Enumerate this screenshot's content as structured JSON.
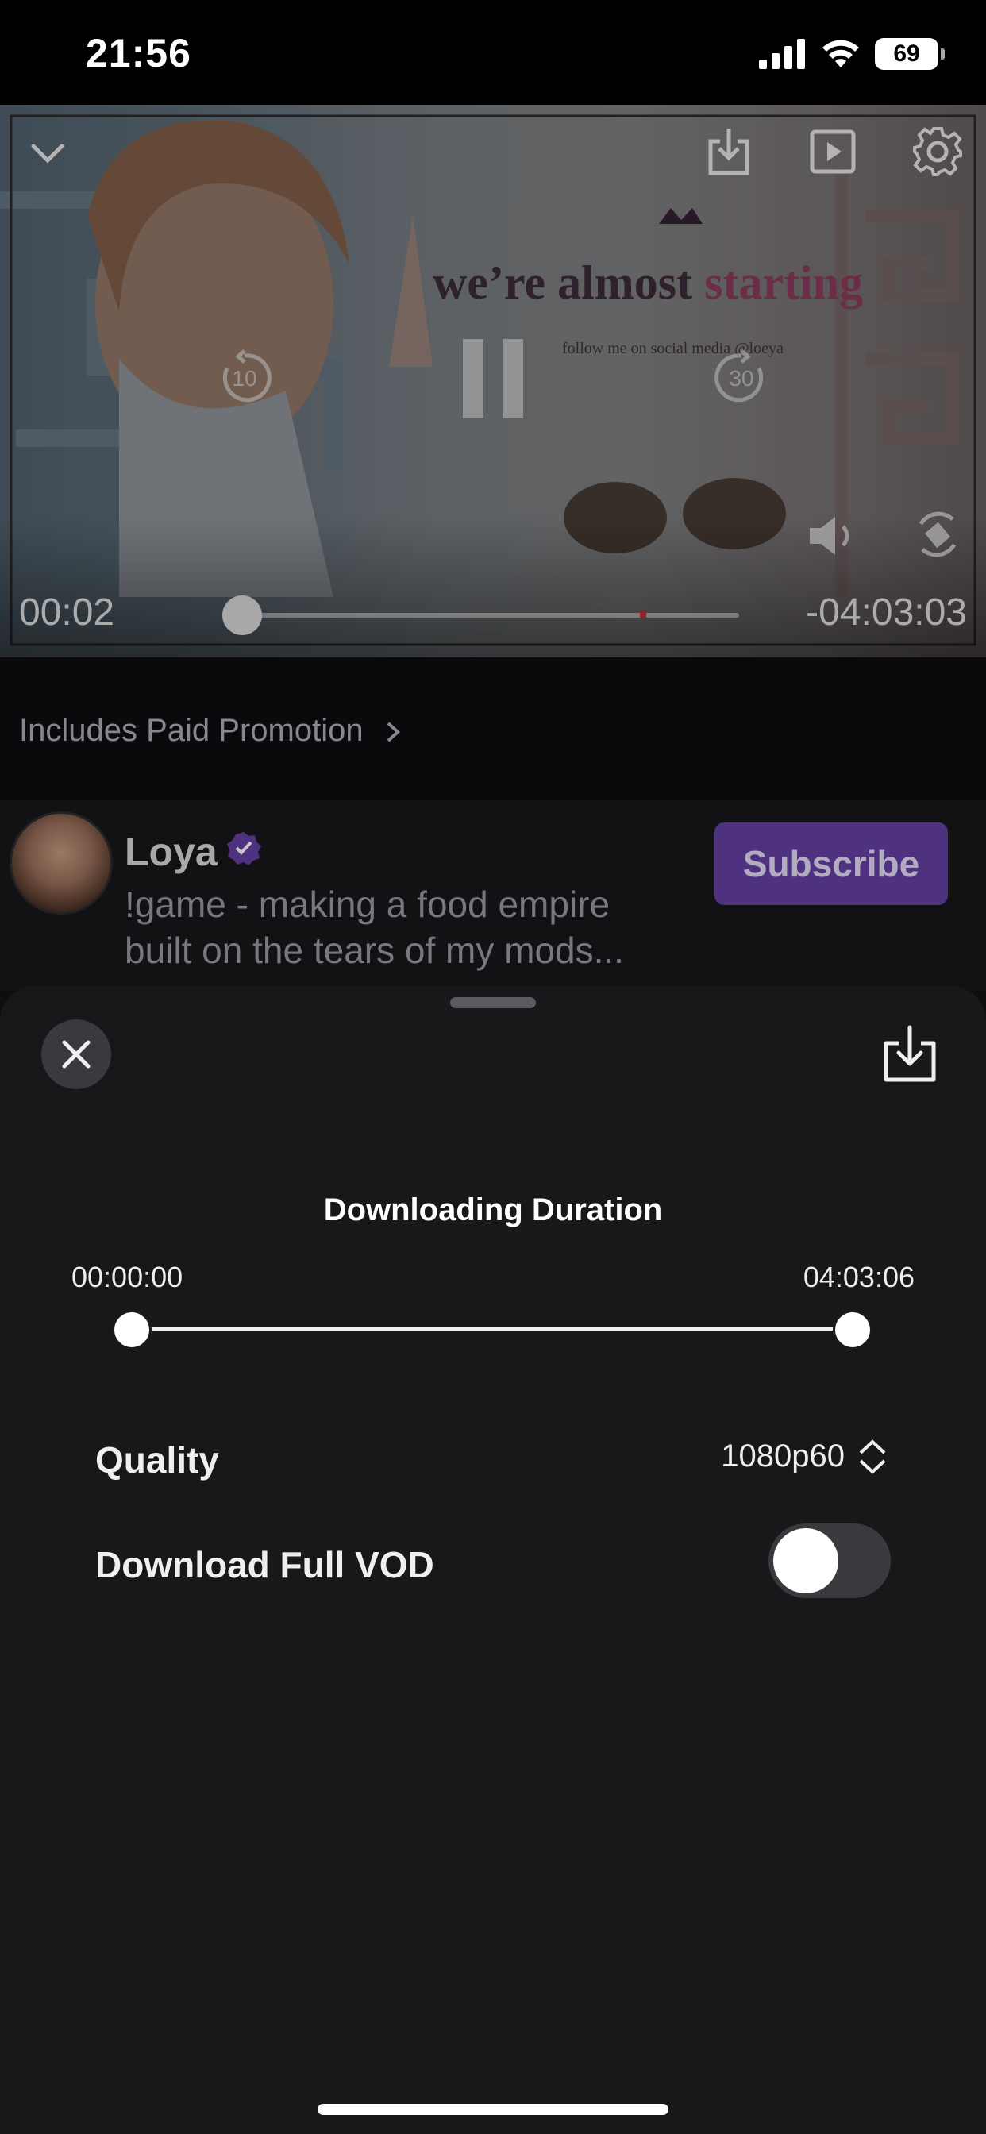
{
  "status_bar": {
    "time": "21:56",
    "battery": "69"
  },
  "video": {
    "overlay_title_main": "we’re almost",
    "overlay_title_accent": "starting",
    "overlay_subtitle": "follow me on social media @loeya",
    "rewind_label": "10",
    "forward_label": "30",
    "elapsed": "00:02",
    "remaining": "-04:03:03",
    "progress": 0.0
  },
  "promo": {
    "label": "Includes Paid Promotion"
  },
  "channel": {
    "name": "Loya",
    "title": "!game - making a food empire built on the tears of my mods...",
    "subscribe_label": "Subscribe"
  },
  "download_sheet": {
    "heading": "Downloading Duration",
    "range_start": "00:00:00",
    "range_end": "04:03:06",
    "range_start_fraction": 0.0,
    "range_end_fraction": 1.0,
    "quality_label": "Quality",
    "quality_value": "1080p60",
    "full_vod_label": "Download Full VOD",
    "full_vod_enabled": false
  },
  "colors": {
    "accent": "#6441a5",
    "sheet_bg": "#18181a"
  }
}
